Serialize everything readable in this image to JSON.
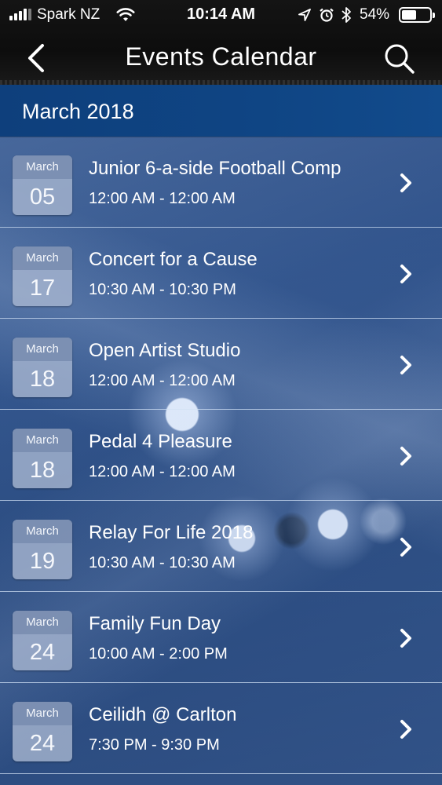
{
  "status_bar": {
    "carrier": "Spark NZ",
    "time": "10:14 AM",
    "battery_percent": "54%",
    "battery_level": 0.54,
    "icons": [
      "signal-icon",
      "wifi-icon",
      "location-icon",
      "alarm-icon",
      "bluetooth-icon",
      "battery-icon"
    ]
  },
  "nav": {
    "title": "Events Calendar",
    "back_icon": "back-chevron-icon",
    "search_icon": "search-icon"
  },
  "month_header": "March 2018",
  "events": [
    {
      "month": "March",
      "day": "05",
      "title": "Junior 6-a-side Football Comp",
      "time": "12:00 AM - 12:00 AM"
    },
    {
      "month": "March",
      "day": "17",
      "title": "Concert for a Cause",
      "time": "10:30 AM - 10:30 PM"
    },
    {
      "month": "March",
      "day": "18",
      "title": "Open Artist Studio",
      "time": "12:00 AM - 12:00 AM"
    },
    {
      "month": "March",
      "day": "18",
      "title": "Pedal 4 Pleasure",
      "time": "12:00 AM - 12:00 AM"
    },
    {
      "month": "March",
      "day": "19",
      "title": "Relay For Life 2018",
      "time": "10:30 AM - 10:30 AM"
    },
    {
      "month": "March",
      "day": "24",
      "title": "Family Fun Day",
      "time": "10:00 AM - 2:00 PM"
    },
    {
      "month": "March",
      "day": "24",
      "title": "Ceilidh @ Carlton",
      "time": "7:30 PM - 9:30 PM"
    }
  ],
  "colors": {
    "nav_background": "#111111",
    "month_header": "#0f4584",
    "list_background": "#2e5088",
    "date_box": "#aab9d2"
  }
}
